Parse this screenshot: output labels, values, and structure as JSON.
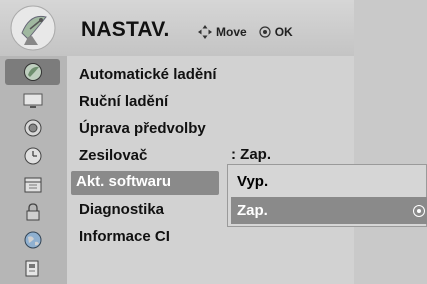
{
  "header": {
    "title": "NASTAV.",
    "hint_move": "Move",
    "hint_ok": "OK",
    "icon": "satellite-dish-icon"
  },
  "sidebar": {
    "items": [
      {
        "icon": "dish-icon",
        "active": true
      },
      {
        "icon": "picture-icon",
        "active": false
      },
      {
        "icon": "speaker-icon",
        "active": false
      },
      {
        "icon": "clock-icon",
        "active": false
      },
      {
        "icon": "calendar-icon",
        "active": false
      },
      {
        "icon": "lock-icon",
        "active": false
      },
      {
        "icon": "globe-icon",
        "active": false
      },
      {
        "icon": "usb-icon",
        "active": false
      }
    ]
  },
  "menu": {
    "items": [
      {
        "label": "Automatické ladění"
      },
      {
        "label": "Ruční ladění"
      },
      {
        "label": "Úprava předvolby"
      },
      {
        "label": "Zesilovač",
        "value": ": Zap."
      },
      {
        "label": "Akt. softwaru",
        "selected": true
      },
      {
        "label": "Diagnostika"
      },
      {
        "label": "Informace CI"
      }
    ]
  },
  "popup": {
    "options": [
      {
        "label": "Vyp.",
        "selected": false
      },
      {
        "label": "Zap.",
        "selected": true
      }
    ]
  },
  "colors": {
    "background": "#c9c9c9",
    "selected": "#8a8a8a",
    "active_icon": "#7c7c7c"
  }
}
